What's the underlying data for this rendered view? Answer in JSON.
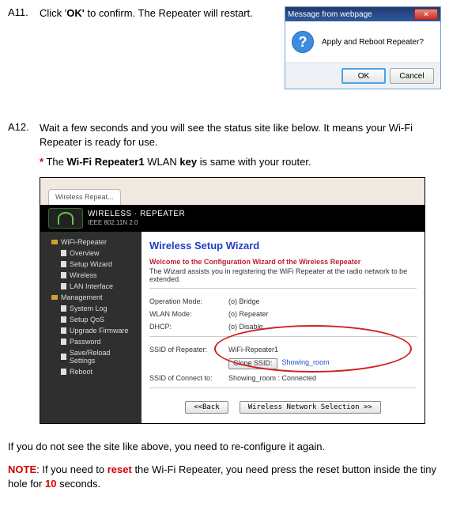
{
  "steps": {
    "a11": {
      "label": "A11.",
      "text_pre": "Click '",
      "bold1": "OK'",
      "text_post": " to confirm. The Repeater will restart."
    },
    "a12": {
      "label": "A12.",
      "text": "Wait a few seconds and you will see the status site like below. It means your Wi-Fi Repeater is ready for use.",
      "note_star": "*",
      "note_pre": " The ",
      "note_bold1": "Wi-Fi Repeater1",
      "note_mid": " WLAN ",
      "note_bold2": "key",
      "note_post": " is same with your router."
    }
  },
  "dialog": {
    "title": "Message from webpage",
    "close": "✕",
    "icon": "?",
    "message": "Apply and Reboot Repeater?",
    "ok": "OK",
    "cancel": "Cancel"
  },
  "router": {
    "tab": "Wireless Repeat...",
    "head_title": "WIRELESS · REPEATER",
    "head_sub": "IEEE 802.11N 2.0",
    "sidebar": {
      "items": [
        "WiFi-Repeater",
        "Overview",
        "Setup Wizard",
        "Wireless",
        "LAN Interface",
        "Management",
        "System Log",
        "Setup QoS",
        "Upgrade Firmware",
        "Password",
        "Save/Reload Settings",
        "Reboot"
      ]
    },
    "content": {
      "title": "Wireless Setup Wizard",
      "subtitle": "Welcome to the Configuration Wizard of the Wireless Repeater",
      "desc": "The Wizard assists you in registering the WiFi Repeater at the radio network to be extended.",
      "rows": {
        "op_mode_lbl": "Operation Mode:",
        "op_mode_val": "(o) Bridge",
        "wlan_mode_lbl": "WLAN Mode:",
        "wlan_mode_val": "(o) Repeater",
        "dhcp_lbl": "DHCP:",
        "dhcp_val": "(o) Disable",
        "ssid_rep_lbl": "SSID of Repeater:",
        "ssid_rep_val": "WiFi-Repeater1",
        "clone_btn": "Clone SSID:",
        "showing": "Showing_room",
        "ssid_conn_lbl": "SSID of Connect to:",
        "ssid_conn_val": "Showing_room : Connected"
      },
      "btn_back": "<<Back",
      "btn_next": "Wireless Network Selection >>"
    }
  },
  "after": {
    "p1": "If you do not see the site like above, you need to re-configure it again.",
    "note_label": "NOTE",
    "p2_a": ": If you need to ",
    "p2_reset": "reset",
    "p2_b": " the Wi-Fi Repeater, you need press the reset button inside the tiny hole for ",
    "p2_ten": "10",
    "p2_c": " seconds."
  }
}
